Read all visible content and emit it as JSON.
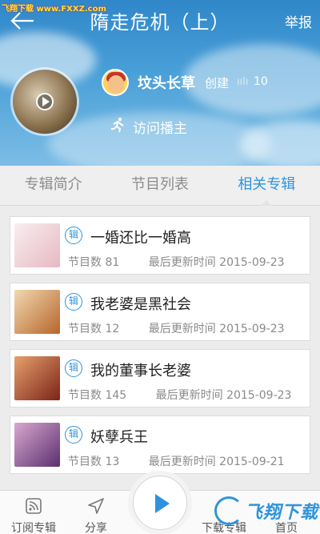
{
  "watermark": "飞翔下载 www.FXXZ.com",
  "header": {
    "title": "隋走危机（上）",
    "report_label": "举报"
  },
  "author": {
    "name": "坟头长草",
    "created_label": "创建",
    "play_count": "10",
    "visit_label": "访问播主"
  },
  "tabs": [
    {
      "label": "专辑简介",
      "active": false
    },
    {
      "label": "节目列表",
      "active": false
    },
    {
      "label": "相关专辑",
      "active": true
    }
  ],
  "albums": [
    {
      "badge": "辑",
      "title": "一婚还比一婚高",
      "episodes_label": "节目数 81",
      "updated_label": "最后更新时间 2015-09-23",
      "cover_color": "#f3e3e6"
    },
    {
      "badge": "辑",
      "title": "我老婆是黑社会",
      "episodes_label": "节目数 12",
      "updated_label": "最后更新时间 2015-09-23",
      "cover_color": "#e7c29a"
    },
    {
      "badge": "辑",
      "title": "我的董事长老婆",
      "episodes_label": "节目数 145",
      "updated_label": "最后更新时间 2015-09-23",
      "cover_color": "#b9532f"
    },
    {
      "badge": "辑",
      "title": "妖孽兵王",
      "episodes_label": "节目数 13",
      "updated_label": "最后更新时间 2015-09-21",
      "cover_color": "#9c5a8f"
    }
  ],
  "bottom_nav": {
    "subscribe_label": "订阅专辑",
    "share_label": "分享",
    "download_label": "下载专辑",
    "home_label": "首页",
    "logo_text": "飞翔下载"
  },
  "colors": {
    "accent": "#2e93dc",
    "header_bg": "#3b93d0"
  }
}
